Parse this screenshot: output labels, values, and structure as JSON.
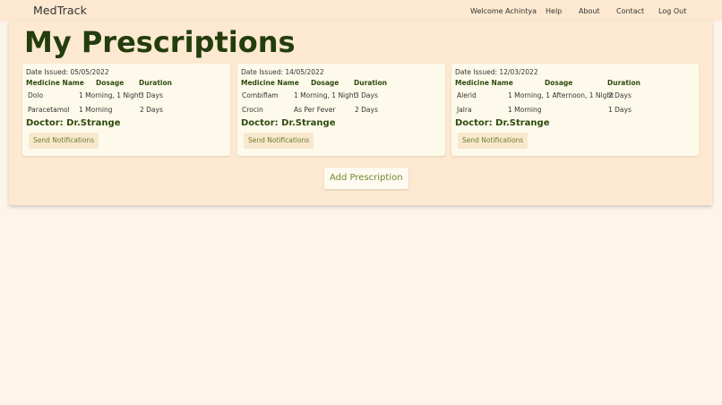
{
  "navbar": {
    "brand": "MedTrack",
    "welcome": "Welcome Achintya",
    "links": [
      "Help",
      "About",
      "Contact",
      "Log Out"
    ]
  },
  "page_title": "My Prescriptions",
  "table_headers": [
    "Medicine Name",
    "Dosage",
    "Duration"
  ],
  "prescriptions": [
    {
      "date_issued": "Date Issued: 05/05/2022",
      "medicines": [
        {
          "name": "Dolo",
          "dosage": "1 Morning, 1 Night",
          "duration": "3 Days"
        },
        {
          "name": "Paracetamol",
          "dosage": "1 Morning",
          "duration": "2 Days"
        }
      ],
      "doctor": "Doctor: Dr.Strange",
      "notify_label": "Send Notifications"
    },
    {
      "date_issued": "Date Issued: 14/05/2022",
      "medicines": [
        {
          "name": "Combiflam",
          "dosage": "1 Morning, 1 Night",
          "duration": "3 Days"
        },
        {
          "name": "Crocin",
          "dosage": "As Per Fever",
          "duration": "2 Days"
        }
      ],
      "doctor": "Doctor: Dr.Strange",
      "notify_label": "Send Notifications"
    },
    {
      "date_issued": "Date Issued: 12/03/2022",
      "medicines": [
        {
          "name": "Alerid",
          "dosage": "1 Morning, 1 Afternoon, 1 Night",
          "duration": "2 Days"
        },
        {
          "name": "Jalra",
          "dosage": "1 Morning",
          "duration": "1 Days"
        }
      ],
      "doctor": "Doctor: Dr.Strange",
      "notify_label": "Send Notifications"
    }
  ],
  "add_button_label": "Add Prescription",
  "colors": {
    "page_bg": "#fdf4ea",
    "panel_bg": "#fde9d1",
    "card_bg": "#fefaeb",
    "title_green": "#233d0c",
    "accent_green": "#6f8a2d"
  }
}
